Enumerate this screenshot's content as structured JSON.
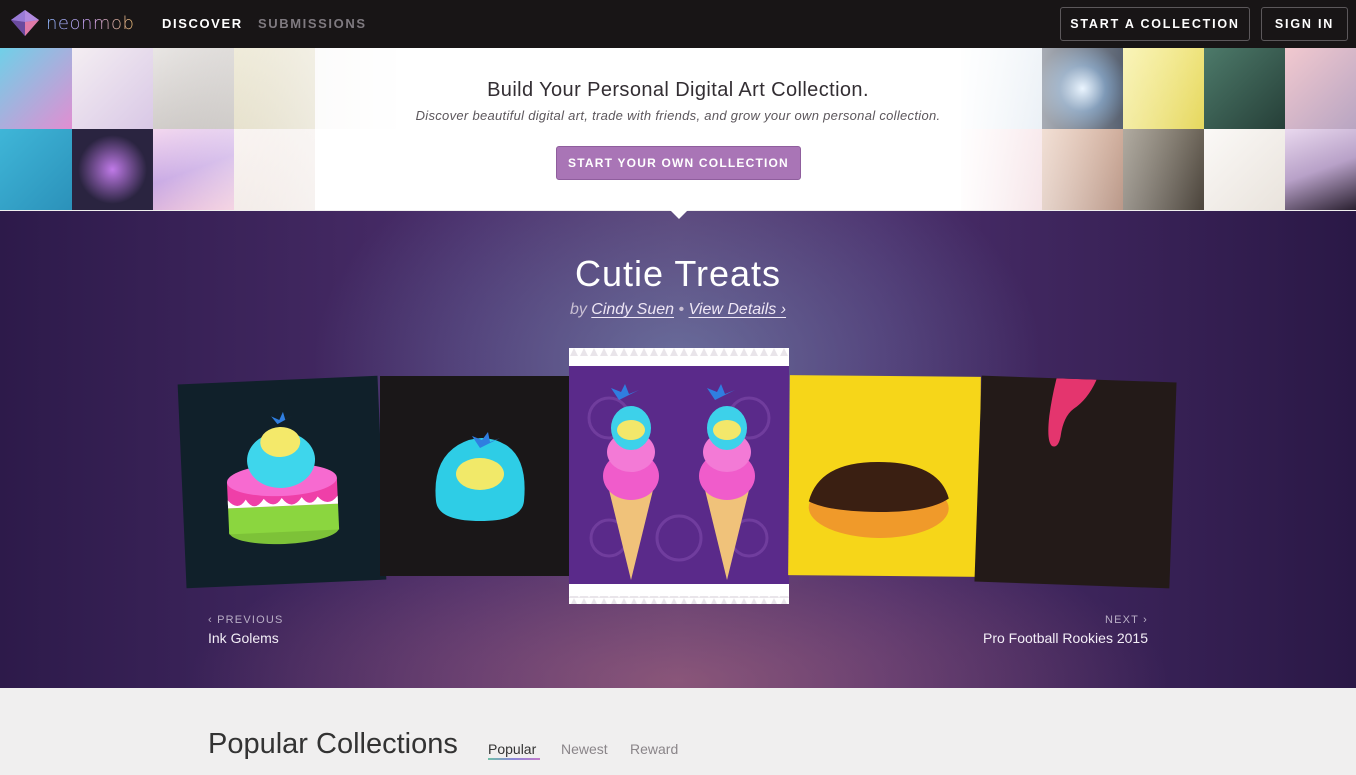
{
  "nav": {
    "logo_text": "neonmob",
    "discover": "DISCOVER",
    "submissions": "SUBMISSIONS",
    "start_collection": "START A COLLECTION",
    "sign_in": "SIGN IN"
  },
  "hero": {
    "title": "Build Your Personal Digital Art Collection.",
    "subtitle": "Discover beautiful digital art, trade with friends, and grow your own personal collection.",
    "cta": "START YOUR OWN COLLECTION"
  },
  "featured": {
    "title": "Cutie Treats",
    "by_prefix": "by",
    "artist": "Cindy Suen",
    "separator": "•",
    "details": "View Details ›",
    "previous_label": "‹ PREVIOUS",
    "previous_name": "Ink Golems",
    "next_label": "NEXT ›",
    "next_name": "Pro Football Rookies 2015"
  },
  "popular": {
    "title": "Popular Collections",
    "tabs": [
      "Popular",
      "Newest",
      "Reward"
    ],
    "active_tab": "Popular"
  },
  "colors": {
    "nav_bg": "#181516",
    "cta_purple": "#a975b6",
    "featured_purple": "#4a2d6a"
  }
}
